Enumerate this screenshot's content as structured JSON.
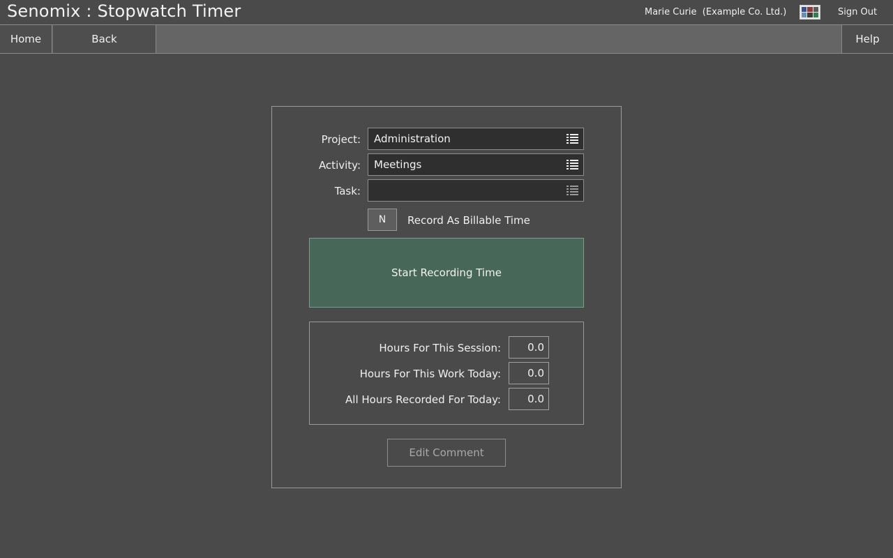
{
  "header": {
    "app_title": "Senomix : Stopwatch Timer",
    "user": "Marie Curie  (Example Co. Ltd.)",
    "theme_icon": "color-palette-icon",
    "sign_out": "Sign Out"
  },
  "nav": {
    "home": "Home",
    "back": "Back",
    "help": "Help"
  },
  "form": {
    "project_label": "Project:",
    "project_value": "Administration",
    "activity_label": "Activity:",
    "activity_value": "Meetings",
    "task_label": "Task:",
    "task_value": "",
    "list_icon": "list-icon",
    "billable_toggle": "N",
    "billable_label": "Record As Billable Time",
    "start_button": "Start Recording Time"
  },
  "hours": {
    "session_label": "Hours For This Session:",
    "session_value": "0.0",
    "work_today_label": "Hours For This Work Today:",
    "work_today_value": "0.0",
    "all_today_label": "All Hours Recorded For Today:",
    "all_today_value": "0.0"
  },
  "edit_comment": "Edit Comment",
  "colors": {
    "background": "#4a4a4a",
    "navbar": "#656565",
    "start_button": "#476858",
    "input_bg": "#2f2f2f"
  }
}
